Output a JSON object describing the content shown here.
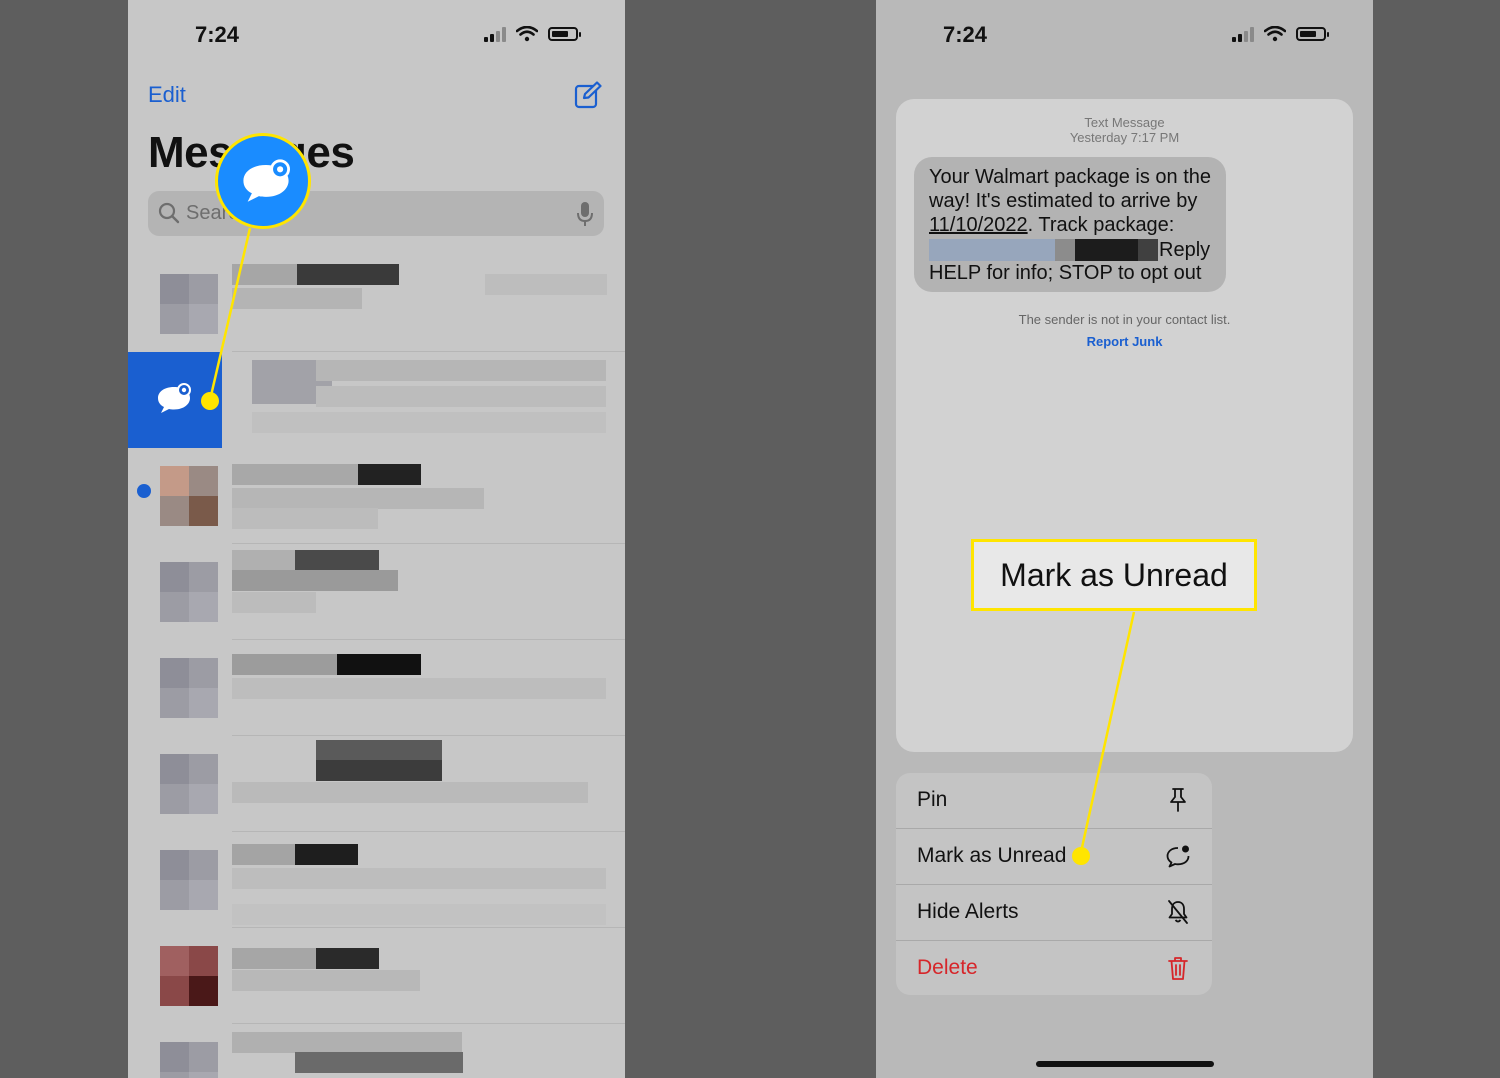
{
  "left_phone": {
    "status_time": "7:24",
    "edit_label": "Edit",
    "title": "Messages",
    "search_placeholder": "Search",
    "icons": [
      "compose-icon",
      "search-icon",
      "microphone-icon",
      "unread-chat-bubble-icon"
    ]
  },
  "right_phone": {
    "status_time": "7:24",
    "message_kind": "Text Message",
    "message_time": "Yesterday 7:17 PM",
    "message_line1": "Your Walmart package is on the way! It's estimated to arrive by",
    "message_date": "11/10/2022",
    "message_line2": ". Track package:",
    "message_reply": "Reply",
    "message_help": "HELP for info; STOP to opt out",
    "sender_note": "The sender is not in your contact list.",
    "report_junk": "Report Junk",
    "callout_label": "Mark as Unread",
    "menu": [
      {
        "label": "Pin",
        "icon": "pin-icon"
      },
      {
        "label": "Mark as Unread",
        "icon": "unread-bubble-icon"
      },
      {
        "label": "Hide Alerts",
        "icon": "bell-slash-icon"
      },
      {
        "label": "Delete",
        "icon": "trash-icon",
        "color": "#d6262a"
      }
    ]
  },
  "colors": {
    "accent": "#1a5fd0",
    "highlight": "#ffe500",
    "destructive": "#d6262a"
  }
}
